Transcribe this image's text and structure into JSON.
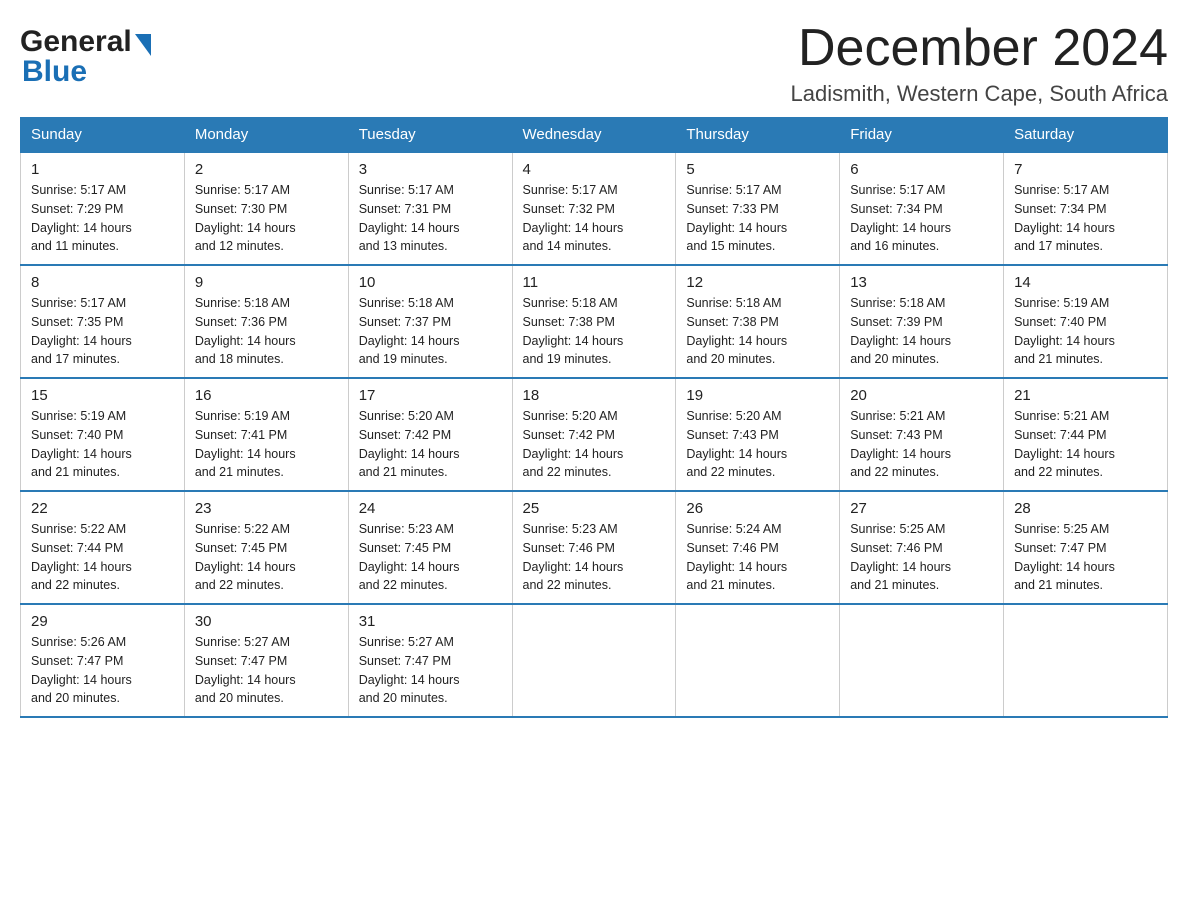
{
  "header": {
    "month_title": "December 2024",
    "location": "Ladismith, Western Cape, South Africa",
    "logo_general": "General",
    "logo_blue": "Blue"
  },
  "weekdays": [
    "Sunday",
    "Monday",
    "Tuesday",
    "Wednesday",
    "Thursday",
    "Friday",
    "Saturday"
  ],
  "weeks": [
    [
      {
        "day": "1",
        "sunrise": "5:17 AM",
        "sunset": "7:29 PM",
        "daylight": "14 hours and 11 minutes."
      },
      {
        "day": "2",
        "sunrise": "5:17 AM",
        "sunset": "7:30 PM",
        "daylight": "14 hours and 12 minutes."
      },
      {
        "day": "3",
        "sunrise": "5:17 AM",
        "sunset": "7:31 PM",
        "daylight": "14 hours and 13 minutes."
      },
      {
        "day": "4",
        "sunrise": "5:17 AM",
        "sunset": "7:32 PM",
        "daylight": "14 hours and 14 minutes."
      },
      {
        "day": "5",
        "sunrise": "5:17 AM",
        "sunset": "7:33 PM",
        "daylight": "14 hours and 15 minutes."
      },
      {
        "day": "6",
        "sunrise": "5:17 AM",
        "sunset": "7:34 PM",
        "daylight": "14 hours and 16 minutes."
      },
      {
        "day": "7",
        "sunrise": "5:17 AM",
        "sunset": "7:34 PM",
        "daylight": "14 hours and 17 minutes."
      }
    ],
    [
      {
        "day": "8",
        "sunrise": "5:17 AM",
        "sunset": "7:35 PM",
        "daylight": "14 hours and 17 minutes."
      },
      {
        "day": "9",
        "sunrise": "5:18 AM",
        "sunset": "7:36 PM",
        "daylight": "14 hours and 18 minutes."
      },
      {
        "day": "10",
        "sunrise": "5:18 AM",
        "sunset": "7:37 PM",
        "daylight": "14 hours and 19 minutes."
      },
      {
        "day": "11",
        "sunrise": "5:18 AM",
        "sunset": "7:38 PM",
        "daylight": "14 hours and 19 minutes."
      },
      {
        "day": "12",
        "sunrise": "5:18 AM",
        "sunset": "7:38 PM",
        "daylight": "14 hours and 20 minutes."
      },
      {
        "day": "13",
        "sunrise": "5:18 AM",
        "sunset": "7:39 PM",
        "daylight": "14 hours and 20 minutes."
      },
      {
        "day": "14",
        "sunrise": "5:19 AM",
        "sunset": "7:40 PM",
        "daylight": "14 hours and 21 minutes."
      }
    ],
    [
      {
        "day": "15",
        "sunrise": "5:19 AM",
        "sunset": "7:40 PM",
        "daylight": "14 hours and 21 minutes."
      },
      {
        "day": "16",
        "sunrise": "5:19 AM",
        "sunset": "7:41 PM",
        "daylight": "14 hours and 21 minutes."
      },
      {
        "day": "17",
        "sunrise": "5:20 AM",
        "sunset": "7:42 PM",
        "daylight": "14 hours and 21 minutes."
      },
      {
        "day": "18",
        "sunrise": "5:20 AM",
        "sunset": "7:42 PM",
        "daylight": "14 hours and 22 minutes."
      },
      {
        "day": "19",
        "sunrise": "5:20 AM",
        "sunset": "7:43 PM",
        "daylight": "14 hours and 22 minutes."
      },
      {
        "day": "20",
        "sunrise": "5:21 AM",
        "sunset": "7:43 PM",
        "daylight": "14 hours and 22 minutes."
      },
      {
        "day": "21",
        "sunrise": "5:21 AM",
        "sunset": "7:44 PM",
        "daylight": "14 hours and 22 minutes."
      }
    ],
    [
      {
        "day": "22",
        "sunrise": "5:22 AM",
        "sunset": "7:44 PM",
        "daylight": "14 hours and 22 minutes."
      },
      {
        "day": "23",
        "sunrise": "5:22 AM",
        "sunset": "7:45 PM",
        "daylight": "14 hours and 22 minutes."
      },
      {
        "day": "24",
        "sunrise": "5:23 AM",
        "sunset": "7:45 PM",
        "daylight": "14 hours and 22 minutes."
      },
      {
        "day": "25",
        "sunrise": "5:23 AM",
        "sunset": "7:46 PM",
        "daylight": "14 hours and 22 minutes."
      },
      {
        "day": "26",
        "sunrise": "5:24 AM",
        "sunset": "7:46 PM",
        "daylight": "14 hours and 21 minutes."
      },
      {
        "day": "27",
        "sunrise": "5:25 AM",
        "sunset": "7:46 PM",
        "daylight": "14 hours and 21 minutes."
      },
      {
        "day": "28",
        "sunrise": "5:25 AM",
        "sunset": "7:47 PM",
        "daylight": "14 hours and 21 minutes."
      }
    ],
    [
      {
        "day": "29",
        "sunrise": "5:26 AM",
        "sunset": "7:47 PM",
        "daylight": "14 hours and 20 minutes."
      },
      {
        "day": "30",
        "sunrise": "5:27 AM",
        "sunset": "7:47 PM",
        "daylight": "14 hours and 20 minutes."
      },
      {
        "day": "31",
        "sunrise": "5:27 AM",
        "sunset": "7:47 PM",
        "daylight": "14 hours and 20 minutes."
      },
      null,
      null,
      null,
      null
    ]
  ],
  "sunrise_label": "Sunrise:",
  "sunset_label": "Sunset:",
  "daylight_label": "Daylight:"
}
